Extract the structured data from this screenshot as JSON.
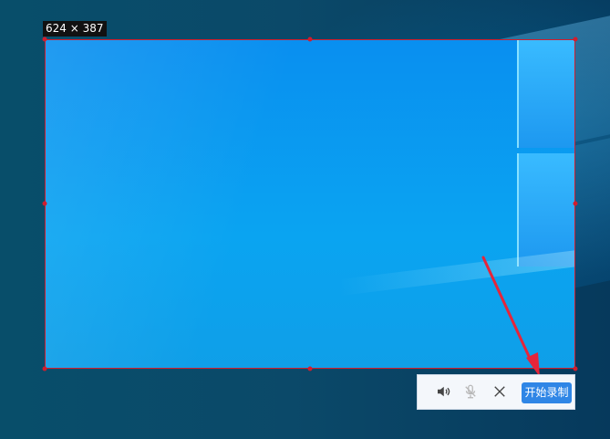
{
  "selection": {
    "dimensions": "624 × 387"
  },
  "toolbar": {
    "speaker_icon": "speaker-icon",
    "microphone_icon": "microphone-muted-icon",
    "close_icon": "close-icon",
    "record_label": "开始录制"
  },
  "colors": {
    "selection_border": "#d21d2d",
    "record_button": "#2f86e6",
    "arrow": "#e5253a"
  }
}
